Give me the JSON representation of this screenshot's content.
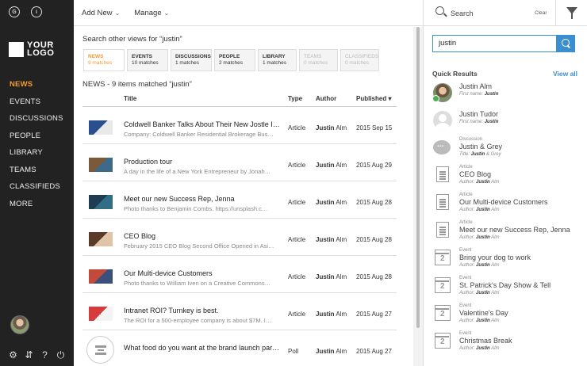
{
  "sidebar": {
    "top_icons": [
      "G",
      "i"
    ],
    "logo_line1": "YOUR",
    "logo_line2": "LOGO",
    "nav": [
      "NEWS",
      "EVENTS",
      "DISCUSSIONS",
      "PEOPLE",
      "LIBRARY",
      "TEAMS",
      "CLASSIFIEDS",
      "MORE"
    ],
    "active_nav": "NEWS",
    "bottom_icons": [
      "gear-icon",
      "sliders-icon",
      "help-icon",
      "power-icon"
    ],
    "bottom_glyphs": [
      "⚙",
      "⇵",
      "?",
      "⏻"
    ]
  },
  "topbar": {
    "add_new": "Add New",
    "manage": "Manage",
    "chevron": "⌄"
  },
  "main": {
    "search_views_title": "Search other views for “justin”",
    "tabs": [
      {
        "label": "NEWS",
        "count": "9 matches",
        "state": "active"
      },
      {
        "label": "EVENTS",
        "count": "10 matches",
        "state": "normal"
      },
      {
        "label": "DISCUSSIONS",
        "count": "1 matches",
        "state": "normal"
      },
      {
        "label": "PEOPLE",
        "count": "2 matches",
        "state": "normal"
      },
      {
        "label": "LIBRARY",
        "count": "1 matches",
        "state": "normal"
      },
      {
        "label": "TEAMS",
        "count": "0 matches",
        "state": "disabled"
      },
      {
        "label": "CLASSIFIEDS",
        "count": "0 matches",
        "state": "disabled"
      }
    ],
    "results_title": "NEWS - 9 items matched “justin”",
    "columns": {
      "title": "Title",
      "type": "Type",
      "author": "Author",
      "published": "Published ▾"
    },
    "rows": [
      {
        "title": "Coldwell Banker Talks About Their New Jostle Int…",
        "sub": "Company: Coldwell Banker Residential Brokerage Bus…",
        "type": "Article",
        "author_first": "Justin",
        "author_last": "Alm",
        "date": "2015 Sep 15",
        "thumb_colors": [
          "#2a4f8e",
          "#e9e9e9"
        ]
      },
      {
        "title": "Production tour",
        "sub": "A day in the life of a New York Entrepreneur by Jonah…",
        "type": "Article",
        "author_first": "Justin",
        "author_last": "Alm",
        "date": "2015 Aug 29",
        "thumb_colors": [
          "#7a5a3a",
          "#3e6a8a"
        ]
      },
      {
        "title": "Meet our new Success Rep, Jenna",
        "sub": "Photo thanks to Benjamin Combs. https://unsplash.c…",
        "type": "Article",
        "author_first": "Justin",
        "author_last": "Alm",
        "date": "2015 Aug 28",
        "thumb_colors": [
          "#1e3d52",
          "#2f6e86"
        ]
      },
      {
        "title": "CEO Blog",
        "sub": "February 2015 CEO Blog Second Office Opened in Asi…",
        "type": "Article",
        "author_first": "Justin",
        "author_last": "Alm",
        "date": "2015 Aug 28",
        "thumb_colors": [
          "#5a3b2a",
          "#e0c4a8"
        ]
      },
      {
        "title": "Our Multi-device Customers",
        "sub": "Photo thanks to William Iven on a Creative Commons…",
        "type": "Article",
        "author_first": "Justin",
        "author_last": "Alm",
        "date": "2015 Aug 28",
        "thumb_colors": [
          "#c24a3a",
          "#3a4f7a"
        ]
      },
      {
        "title": "Intranet ROI? Turnkey is best.",
        "sub": "The ROI for a 500-employee company is about $7M. I…",
        "type": "Article",
        "author_first": "Justin",
        "author_last": "Alm",
        "date": "2015 Aug 27",
        "thumb_colors": [
          "#d83b3b",
          "#f3f3f3"
        ]
      },
      {
        "title": "What food do you want at the brand launch part…",
        "sub": "",
        "type": "Poll",
        "author_first": "Justin",
        "author_last": "Alm",
        "date": "2015 Aug 27",
        "thumb_colors": []
      }
    ]
  },
  "right": {
    "search_label": "Search",
    "clear": "Clear",
    "search_value": "justin",
    "quick_results": "Quick Results",
    "view_all": "View all",
    "items": [
      {
        "icon": "user-photo-icon",
        "cat": "",
        "name": "Justin Alm",
        "meta_label": "First name:",
        "meta_value": "Justin",
        "meta_rest": ""
      },
      {
        "icon": "user-placeholder-icon",
        "cat": "",
        "name": "Justin Tudor",
        "meta_label": "First name:",
        "meta_value": "Justin",
        "meta_rest": ""
      },
      {
        "icon": "chat-icon",
        "cat": "Discussion",
        "name": "Justin & Grey",
        "meta_label": "Title:",
        "meta_value": "Justin",
        "meta_rest": "& Grey"
      },
      {
        "icon": "document-icon",
        "cat": "Article",
        "name": "CEO Blog",
        "meta_label": "Author:",
        "meta_value": "Justin",
        "meta_rest": "Alm"
      },
      {
        "icon": "document-icon",
        "cat": "Article",
        "name": "Our Multi-device Customers",
        "meta_label": "Author:",
        "meta_value": "Justin",
        "meta_rest": "Alm"
      },
      {
        "icon": "document-icon",
        "cat": "Article",
        "name": "Meet our new Success Rep, Jenna",
        "meta_label": "Author:",
        "meta_value": "Justin",
        "meta_rest": "Alm"
      },
      {
        "icon": "calendar-icon",
        "cat": "Event",
        "name": "Bring your dog to work",
        "meta_label": "Author:",
        "meta_value": "Justin",
        "meta_rest": "Alm"
      },
      {
        "icon": "calendar-icon",
        "cat": "Event",
        "name": "St. Patrick's Day Show & Tell",
        "meta_label": "Author:",
        "meta_value": "Justin",
        "meta_rest": "Alm"
      },
      {
        "icon": "calendar-icon",
        "cat": "Event",
        "name": "Valentine's Day",
        "meta_label": "Author:",
        "meta_value": "Justin",
        "meta_rest": "Alm"
      },
      {
        "icon": "calendar-icon",
        "cat": "Event",
        "name": "Christmas Break",
        "meta_label": "Author:",
        "meta_value": "Justin",
        "meta_rest": "Alm"
      }
    ],
    "calendar_glyph": "2"
  },
  "colors": {
    "accent": "#f29b2e",
    "link": "#3b8fd0",
    "sidebar_bg": "#222222"
  }
}
